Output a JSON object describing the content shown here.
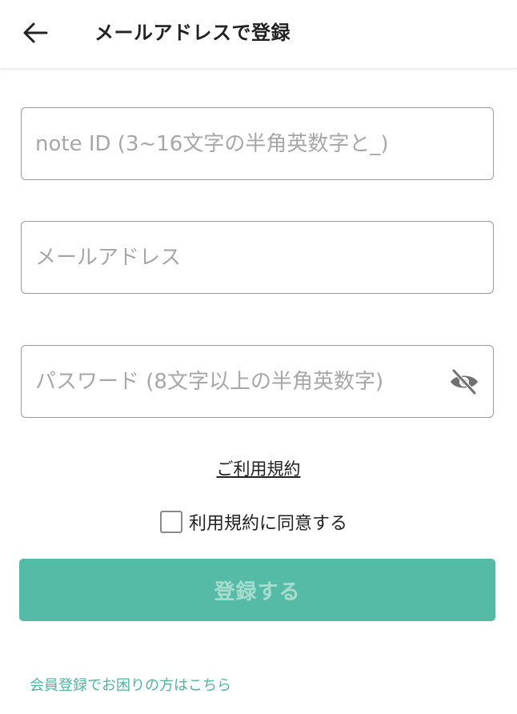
{
  "header": {
    "back_icon": "arrow-left-icon",
    "title": "メールアドレスで登録"
  },
  "form": {
    "note_id": {
      "placeholder": "note ID (3~16文字の半角英数字と_)",
      "value": ""
    },
    "email": {
      "placeholder": "メールアドレス",
      "value": ""
    },
    "password": {
      "placeholder": "パスワード (8文字以上の半角英数字)",
      "value": "",
      "visibility_icon": "eye-off-icon"
    }
  },
  "terms": {
    "link_label": "ご利用規約",
    "agree_label": "利用規約に同意する",
    "agree_checked": false
  },
  "submit": {
    "label": "登録する"
  },
  "help": {
    "link_label": "会員登録でお困りの方はこちら"
  },
  "colors": {
    "accent": "#55bba6",
    "accent_text_disabled": "#a8dccf",
    "link": "#4fb59f",
    "placeholder": "#a7a7a7",
    "border": "#9a9a9a"
  }
}
